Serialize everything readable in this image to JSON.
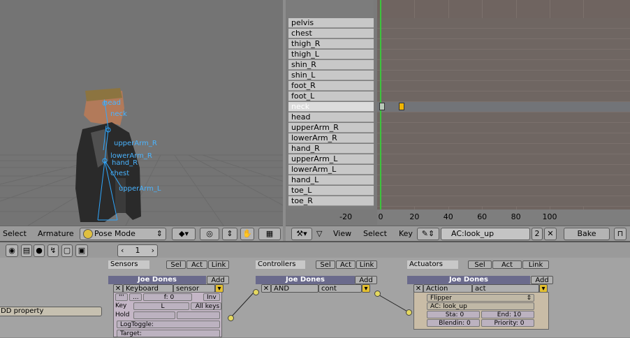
{
  "viewport": {
    "bones": [
      "head",
      "neck",
      "upperArm_R",
      "lowerArm_R",
      "hand_R",
      "chest",
      "upperArm_L"
    ],
    "header": {
      "menu_select": "Select",
      "menu_armature": "Armature",
      "mode": "Pose Mode"
    }
  },
  "action_editor": {
    "channels": [
      "pelvis",
      "chest",
      "thigh_R",
      "thigh_L",
      "shin_R",
      "shin_L",
      "foot_R",
      "foot_L",
      "neck",
      "head",
      "upperArm_R",
      "lowerArm_R",
      "hand_R",
      "upperArm_L",
      "lowerArm_L",
      "hand_L",
      "toe_L",
      "toe_R"
    ],
    "selected_channel": "neck",
    "ruler": [
      "-20",
      "0",
      "20",
      "40",
      "60",
      "80",
      "100"
    ],
    "header": {
      "menu_view": "View",
      "menu_select": "Select",
      "menu_key": "Key",
      "action_name": "AC:look_up",
      "users": "2",
      "bake": "Bake"
    }
  },
  "logic": {
    "sensors": {
      "title": "Sensors",
      "sel": "Sel",
      "act": "Act",
      "link": "Link",
      "object": "Joe Dones",
      "add": "Add",
      "type": "Keyboard",
      "name": "sensor",
      "key_label": "Key",
      "key_value": "L",
      "all_keys": "All keys",
      "hold_label": "Hold",
      "logtoggle": "LogToggle:",
      "target": "Target:",
      "freq": "f: 0",
      "inv": "Inv"
    },
    "controllers": {
      "title": "Controllers",
      "sel": "Sel",
      "act": "Act",
      "link": "Link",
      "object": "Joe Dones",
      "add": "Add",
      "type": "AND",
      "name": "cont"
    },
    "actuators": {
      "title": "Actuators",
      "sel": "Sel",
      "act": "Act",
      "link": "Link",
      "object": "Joe Dones",
      "add": "Add",
      "type": "Action",
      "name": "act",
      "mode": "Flipper",
      "action": "AC: look_up",
      "sta": "Sta: 0",
      "end": "End: 10",
      "blendin": "Blendin: 0",
      "priority": "Priority: 0"
    },
    "add_property": "DD property",
    "frame": "1"
  }
}
